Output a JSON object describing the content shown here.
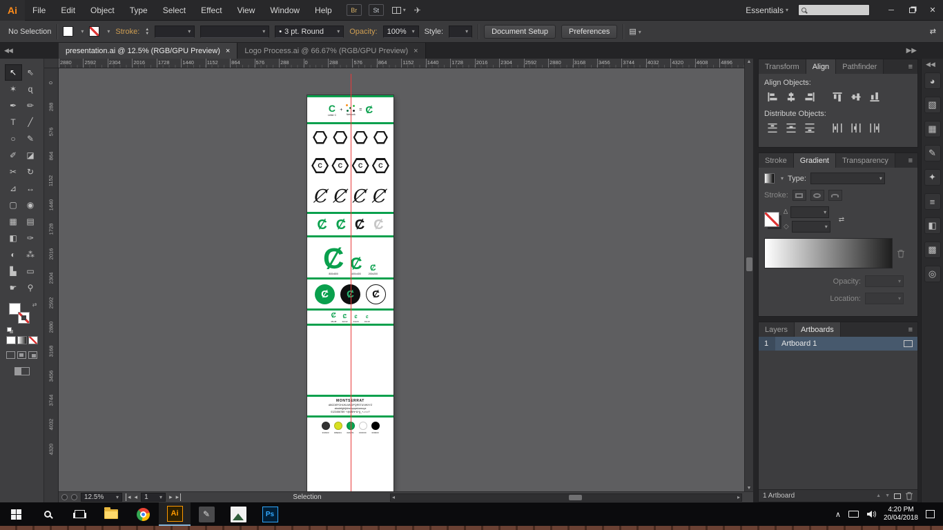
{
  "menubar": {
    "logo": "Ai",
    "items": [
      "File",
      "Edit",
      "Object",
      "Type",
      "Select",
      "Effect",
      "View",
      "Window",
      "Help"
    ],
    "bridge_label": "Br",
    "stock_label": "St",
    "workspace_label": "Essentials"
  },
  "controlbar": {
    "selection_status": "No Selection",
    "stroke_label": "Stroke:",
    "brush_value": "3 pt. Round",
    "opacity_label": "Opacity:",
    "opacity_value": "100%",
    "style_label": "Style:",
    "document_setup": "Document Setup",
    "preferences": "Preferences"
  },
  "tabs": [
    {
      "label": "presentation.ai @ 12.5% (RGB/GPU Preview)",
      "close": "×",
      "active": true
    },
    {
      "label": "Logo Process.ai @ 66.67% (RGB/GPU Preview)",
      "close": "×",
      "active": false
    }
  ],
  "toolbar": {
    "tools": [
      {
        "name": "selection-tool",
        "glyph": "↖",
        "active": true
      },
      {
        "name": "direct-selection-tool",
        "glyph": "⇖"
      },
      {
        "name": "magic-wand-tool",
        "glyph": "✶"
      },
      {
        "name": "lasso-tool",
        "glyph": "ɋ"
      },
      {
        "name": "pen-tool",
        "glyph": "✒"
      },
      {
        "name": "curvature-tool",
        "glyph": "✏"
      },
      {
        "name": "type-tool",
        "glyph": "T"
      },
      {
        "name": "line-segment-tool",
        "glyph": "╱"
      },
      {
        "name": "ellipse-tool",
        "glyph": "○"
      },
      {
        "name": "paintbrush-tool",
        "glyph": "✎"
      },
      {
        "name": "pencil-tool",
        "glyph": "✐"
      },
      {
        "name": "eraser-tool",
        "glyph": "◪"
      },
      {
        "name": "scissors-tool",
        "glyph": "✂"
      },
      {
        "name": "rotate-tool",
        "glyph": "↻"
      },
      {
        "name": "scale-tool",
        "glyph": "⊿"
      },
      {
        "name": "width-tool",
        "glyph": "↔"
      },
      {
        "name": "free-transform-tool",
        "glyph": "▢"
      },
      {
        "name": "shape-builder-tool",
        "glyph": "◉"
      },
      {
        "name": "perspective-grid-tool",
        "glyph": "▦"
      },
      {
        "name": "mesh-tool",
        "glyph": "▤"
      },
      {
        "name": "gradient-tool",
        "glyph": "◧"
      },
      {
        "name": "eyedropper-tool",
        "glyph": "✑"
      },
      {
        "name": "blend-tool",
        "glyph": "◐"
      },
      {
        "name": "symbol-sprayer-tool",
        "glyph": "⁂"
      },
      {
        "name": "column-graph-tool",
        "glyph": "▙"
      },
      {
        "name": "artboard-tool",
        "glyph": "▭"
      },
      {
        "name": "hand-tool",
        "glyph": "☛"
      },
      {
        "name": "zoom-tool",
        "glyph": "⚲"
      }
    ]
  },
  "rulers": {
    "horizontal": [
      "2880",
      "2592",
      "2304",
      "2016",
      "1728",
      "1440",
      "1152",
      "864",
      "576",
      "288",
      "0",
      "288",
      "576",
      "864",
      "1152",
      "1440",
      "1728",
      "2016",
      "2304",
      "2592",
      "2880",
      "3168",
      "3456",
      "3744",
      "4032",
      "4320",
      "4608",
      "4896"
    ],
    "vertical": [
      "0",
      "288",
      "576",
      "864",
      "1152",
      "1440",
      "1728",
      "2016",
      "2304",
      "2592",
      "2880",
      "3168",
      "3456",
      "3744",
      "4032",
      "4320"
    ]
  },
  "dock_icons": [
    {
      "name": "color-panel-icon",
      "glyph": "◕"
    },
    {
      "name": "color-guide-panel-icon",
      "glyph": "▧"
    },
    {
      "name": "swatches-panel-icon",
      "glyph": "▦"
    },
    {
      "name": "brushes-panel-icon",
      "glyph": "✎"
    },
    {
      "name": "symbols-panel-icon",
      "glyph": "✦"
    },
    {
      "name": "stroke-panel-icon",
      "glyph": "≡"
    },
    {
      "name": "gradient-panel-icon",
      "glyph": "◧"
    },
    {
      "name": "transparency-panel-icon",
      "glyph": "▩"
    },
    {
      "name": "appearance-panel-icon",
      "glyph": "◎"
    }
  ],
  "artboard": {
    "logo_glyph": "Ȼ",
    "accent_green": "#0AA04D",
    "idea": {
      "letter": "C",
      "plus": "+",
      "equals": "=",
      "letter_label": "Letter C",
      "network_label": "Network"
    },
    "size_variants": [
      {
        "label": "800x800"
      },
      {
        "label": "400x400"
      },
      {
        "label": "200x200"
      }
    ],
    "small_sizes": [
      "48x48",
      "32x32",
      "24x24",
      "16x16"
    ],
    "font": {
      "name": "MONTSERRAT",
      "upper": "ABCDEFGHIJKLMNOPQRSTUVWXYZ",
      "lower": "abcdefghijklmnopqrstuvwxyz",
      "numerals": "0123456789 ~!@#$%^&*()_+-=<>?"
    },
    "colors": [
      {
        "hex": "#333333",
        "label": "333333"
      },
      {
        "hex": "#D8E021",
        "label": "D8E021"
      },
      {
        "hex": "#00A651",
        "label": "00A651"
      },
      {
        "hex": "#FFFFFF",
        "label": "FFFFFF"
      },
      {
        "hex": "#000000",
        "label": "000000"
      }
    ]
  },
  "panels": {
    "align": {
      "tabs": [
        "Transform",
        "Align",
        "Pathfinder"
      ],
      "align_label": "Align Objects:",
      "distribute_label": "Distribute Objects:"
    },
    "gradient": {
      "tabs": [
        "Stroke",
        "Gradient",
        "Transparency"
      ],
      "type_label": "Type:",
      "stroke_label": "Stroke:",
      "opacity_label": "Opacity:",
      "location_label": "Location:"
    },
    "artboards": {
      "tabs": [
        "Layers",
        "Artboards"
      ],
      "rows": [
        {
          "number": "1",
          "name": "Artboard 1"
        }
      ],
      "footer": "1 Artboard"
    }
  },
  "statusbar": {
    "zoom": "12.5%",
    "artboard_number": "1",
    "status": "Selection"
  },
  "taskbar": {
    "ai_label": "Ai",
    "ps_label": "Ps",
    "time": "4:20 PM",
    "date": "20/04/2018"
  }
}
